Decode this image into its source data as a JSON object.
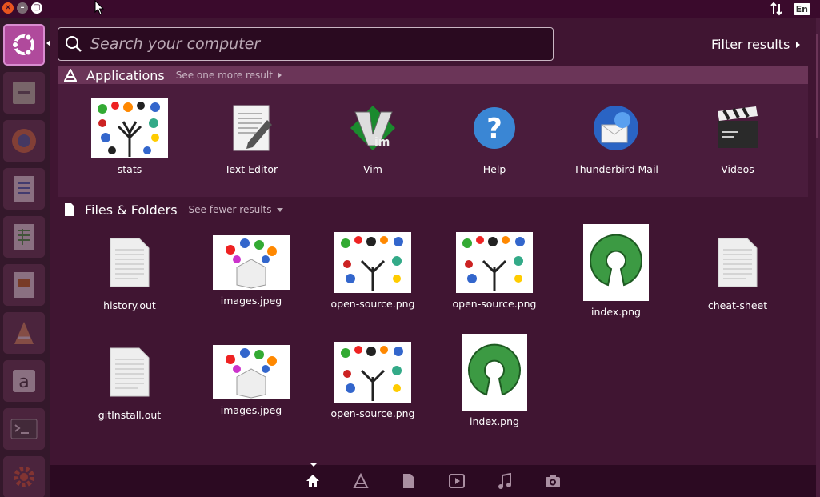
{
  "search": {
    "placeholder": "Search your computer"
  },
  "filter_label": "Filter results",
  "categories": {
    "applications": {
      "title": "Applications",
      "more": "See one more result"
    },
    "files": {
      "title": "Files & Folders",
      "more": "See fewer results"
    }
  },
  "applications": [
    {
      "label": "stats",
      "icon": "open-source-collage-icon"
    },
    {
      "label": "Text Editor",
      "icon": "text-editor-icon"
    },
    {
      "label": "Vim",
      "icon": "vim-icon"
    },
    {
      "label": "Help",
      "icon": "help-icon"
    },
    {
      "label": "Thunderbird Mail",
      "icon": "thunderbird-icon"
    },
    {
      "label": "Videos",
      "icon": "clapperboard-icon"
    }
  ],
  "files": [
    {
      "label": "history.out",
      "icon": "text-file-icon"
    },
    {
      "label": "images.jpeg",
      "icon": "image-thumbnail"
    },
    {
      "label": "open-source.png",
      "icon": "image-thumbnail"
    },
    {
      "label": "open-source.png",
      "icon": "image-thumbnail"
    },
    {
      "label": "index.png",
      "icon": "open-source-logo"
    },
    {
      "label": "cheat-sheet",
      "icon": "text-file-icon"
    },
    {
      "label": "gitInstall.out",
      "icon": "text-file-icon"
    },
    {
      "label": "images.jpeg",
      "icon": "image-thumbnail"
    },
    {
      "label": "open-source.png",
      "icon": "image-thumbnail"
    },
    {
      "label": "index.png",
      "icon": "open-source-logo"
    }
  ],
  "panel": {
    "language": "En"
  },
  "colors": {
    "accent": "#b04a9c",
    "background": "#401532",
    "highlight": "#6b3558"
  }
}
